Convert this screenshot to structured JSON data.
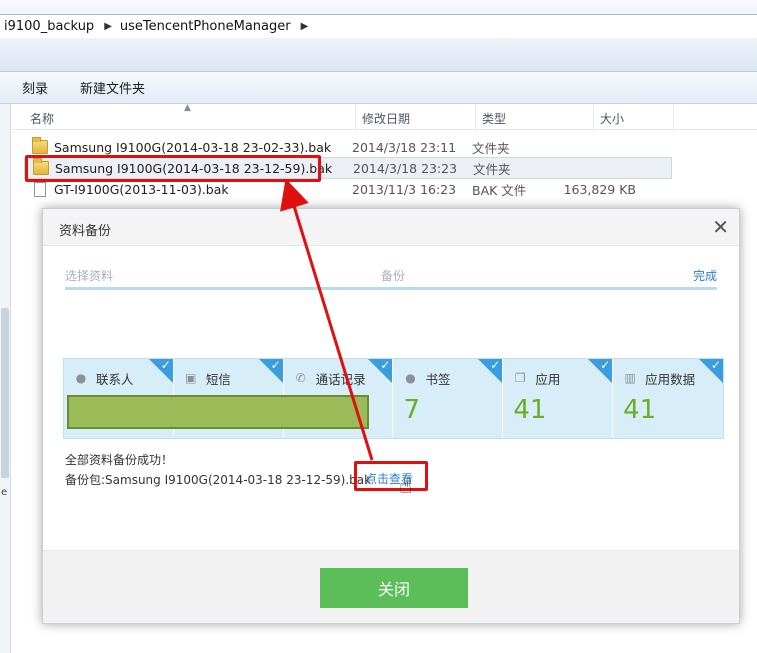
{
  "explorer": {
    "breadcrumbs": [
      "i9100_backup",
      "useTencentPhoneManager"
    ],
    "toolbar": {
      "burn_label": "刻录",
      "new_folder_label": "新建文件夹"
    },
    "columns": {
      "name": "名称",
      "date": "修改日期",
      "type": "类型",
      "size": "大小"
    },
    "files": [
      {
        "name": "Samsung I9100G(2014-03-18 23-02-33).bak",
        "date": "2014/3/18 23:11",
        "type": "文件夹",
        "size": "",
        "kind": "folder-icon"
      },
      {
        "name": "Samsung I9100G(2014-03-18 23-12-59).bak",
        "date": "2014/3/18 23:23",
        "type": "文件夹",
        "size": "",
        "kind": "folder-icon"
      },
      {
        "name": "GT-I9100G(2013-11-03).bak",
        "date": "2013/11/3 16:23",
        "type": "BAK 文件",
        "size": "163,829 KB",
        "kind": "file-icon"
      }
    ],
    "left_marker": "e"
  },
  "dialog": {
    "title": "资料备份",
    "steps": {
      "step1": "选择资料",
      "step2": "备份",
      "step3": "完成"
    },
    "tiles": [
      {
        "label": "联系人",
        "icon": "person-icon",
        "count": ""
      },
      {
        "label": "短信",
        "icon": "message-icon",
        "count": ""
      },
      {
        "label": "通话记录",
        "icon": "phone-icon",
        "count": ""
      },
      {
        "label": "书签",
        "icon": "bookmark-icon",
        "count": "7"
      },
      {
        "label": "应用",
        "icon": "app-icon",
        "count": "41"
      },
      {
        "label": "应用数据",
        "icon": "app-data-icon",
        "count": "41"
      }
    ],
    "success_message": "全部资料备份成功！",
    "package_text": "备份包:Samsung I9100G(2014-03-18 23-12-59).bak",
    "view_link": "点击查看",
    "close_button": "关闭"
  },
  "colors": {
    "accent": "#2b7fd0",
    "success": "#5bbe59",
    "annotation": "#e01010",
    "tile_bg": "#d7edf7",
    "count_green": "#6aad28"
  }
}
